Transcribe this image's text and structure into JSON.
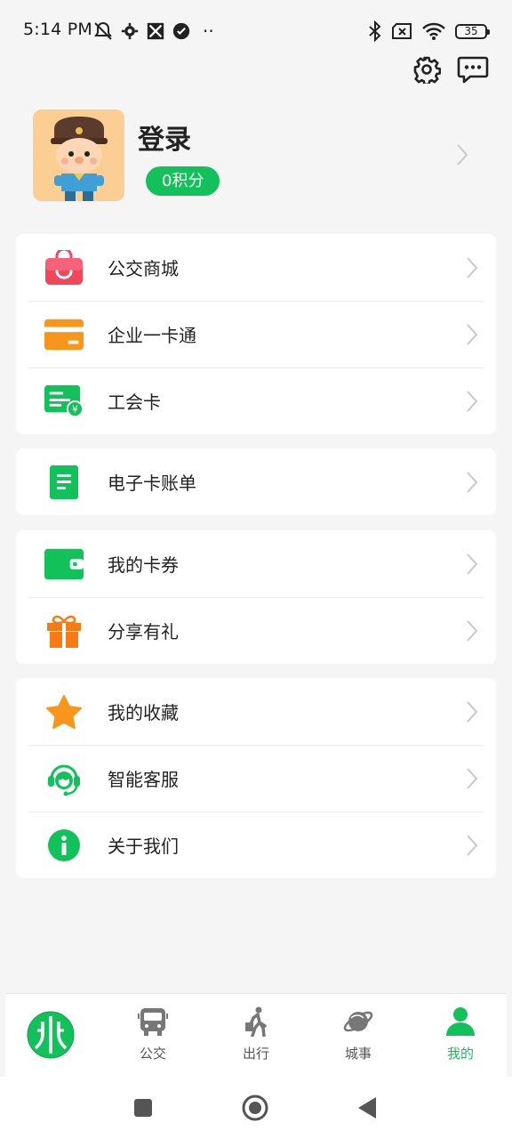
{
  "status_bar": {
    "time": "5:14 PM",
    "battery": "35",
    "icons_left": [
      "mute-icon",
      "settings-gear-icon",
      "app-icon",
      "check-circle-icon",
      "more-dots-icon"
    ],
    "icons_right": [
      "bluetooth-icon",
      "sim-x-icon",
      "wifi-icon",
      "battery-icon"
    ]
  },
  "header": {
    "settings_icon": "gear-icon",
    "message_icon": "chat-icon"
  },
  "profile": {
    "title": "登录",
    "points": "0积分"
  },
  "groups": [
    {
      "items": [
        {
          "label": "公交商城",
          "icon": "shop-bag-icon",
          "color": "#f0485b"
        },
        {
          "label": "企业一卡通",
          "icon": "card-icon",
          "color": "#f7961c"
        },
        {
          "label": "工会卡",
          "icon": "union-card-icon",
          "color": "#13c15a"
        }
      ]
    },
    {
      "items": [
        {
          "label": "电子卡账单",
          "icon": "bill-icon",
          "color": "#13c15a"
        }
      ]
    },
    {
      "items": [
        {
          "label": "我的卡券",
          "icon": "wallet-icon",
          "color": "#13c15a"
        },
        {
          "label": "分享有礼",
          "icon": "gift-icon",
          "color": "#f77b14"
        }
      ]
    },
    {
      "items": [
        {
          "label": "我的收藏",
          "icon": "star-icon",
          "color": "#f7961c"
        },
        {
          "label": "智能客服",
          "icon": "customer-service-icon",
          "color": "#13c15a"
        },
        {
          "label": "关于我们",
          "icon": "info-icon",
          "color": "#13c15a"
        }
      ]
    }
  ],
  "bottom_nav": {
    "items": [
      {
        "label": "公交",
        "icon": "bus-icon"
      },
      {
        "label": "出行",
        "icon": "walker-icon"
      },
      {
        "label": "城事",
        "icon": "planet-icon"
      },
      {
        "label": "我的",
        "icon": "person-icon",
        "active": true
      }
    ]
  },
  "colors": {
    "accent": "#13c15a",
    "background": "#f5f5f5"
  }
}
